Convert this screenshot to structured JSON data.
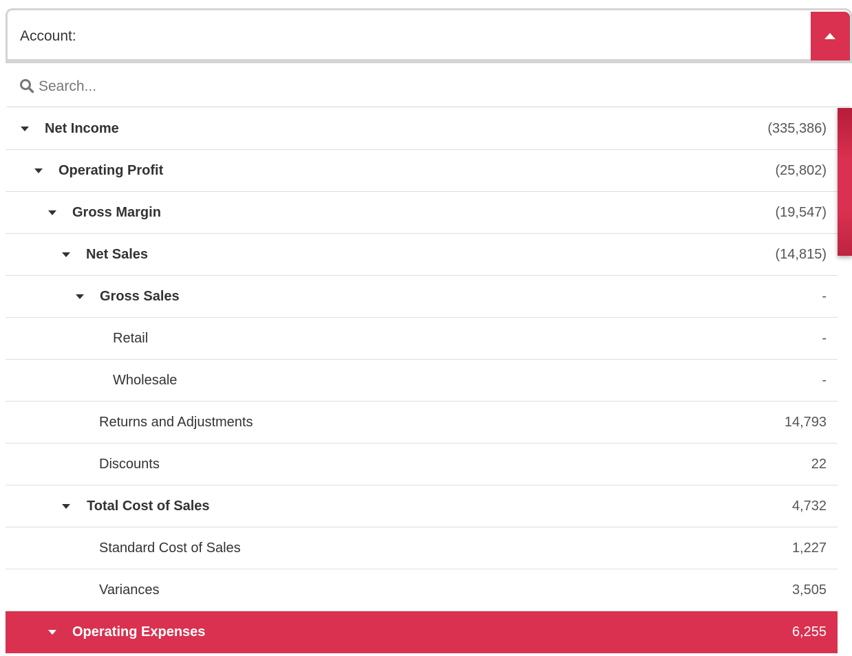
{
  "dropdown": {
    "label": "Account:",
    "toggle_icon": "caret-up-icon",
    "accent_color": "#d9314f"
  },
  "search": {
    "placeholder": "Search...",
    "value": ""
  },
  "rows": [
    {
      "label": "Net Income",
      "value": "(335,386)",
      "expandable": true,
      "bold": true
    },
    {
      "label": "Operating Profit",
      "value": "(25,802)",
      "expandable": true,
      "bold": true
    },
    {
      "label": "Gross Margin",
      "value": "(19,547)",
      "expandable": true,
      "bold": true
    },
    {
      "label": "Net Sales",
      "value": "(14,815)",
      "expandable": true,
      "bold": true
    },
    {
      "label": "Gross Sales",
      "value": "-",
      "expandable": true,
      "bold": true
    },
    {
      "label": "Retail",
      "value": "-",
      "expandable": false,
      "bold": false
    },
    {
      "label": "Wholesale",
      "value": "-",
      "expandable": false,
      "bold": false
    },
    {
      "label": "Returns and Adjustments",
      "value": "14,793",
      "expandable": false,
      "bold": false
    },
    {
      "label": "Discounts",
      "value": "22",
      "expandable": false,
      "bold": false
    },
    {
      "label": "Total Cost of Sales",
      "value": "4,732",
      "expandable": true,
      "bold": true
    },
    {
      "label": "Standard Cost of Sales",
      "value": "1,227",
      "expandable": false,
      "bold": false
    },
    {
      "label": "Variances",
      "value": "3,505",
      "expandable": false,
      "bold": false
    },
    {
      "label": "Operating Expenses",
      "value": "6,255",
      "expandable": true,
      "bold": true,
      "selected": true
    }
  ]
}
